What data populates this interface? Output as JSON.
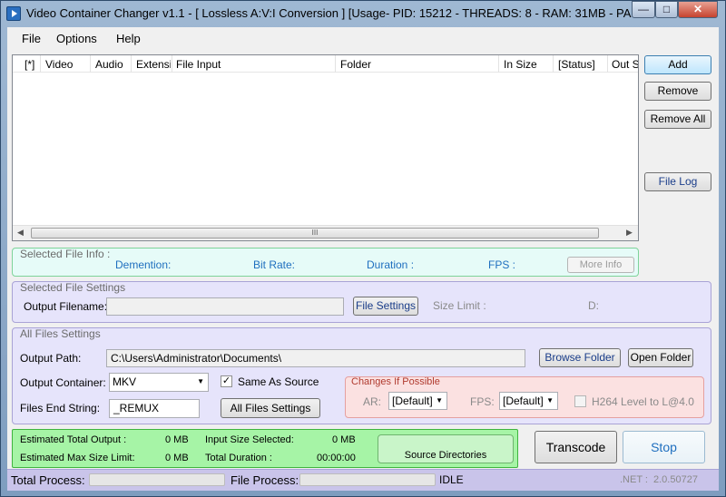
{
  "window": {
    "title": "Video Container Changer v1.1 - [ Lossless A:V:I Conversion ] [Usage- PID: 15212 - THREADS: 8 - RAM: 31MB - PA..."
  },
  "menu": {
    "file": "File",
    "options": "Options",
    "help": "Help"
  },
  "list": {
    "columns": [
      "[*]",
      "Video",
      "Audio",
      "Extensio",
      "File Input",
      "Folder",
      "In Size",
      "[Status]",
      "Out Si"
    ],
    "scroll_grip": "III"
  },
  "side_buttons": {
    "add": "Add",
    "remove": "Remove",
    "remove_all": "Remove All",
    "file_log": "File Log"
  },
  "selected_file_info": {
    "title": "Selected File Info :",
    "demention": "Demention:",
    "bit_rate": "Bit Rate:",
    "duration": "Duration :",
    "fps": "FPS :",
    "more_info": "More Info"
  },
  "selected_file_settings": {
    "title": "Selected File Settings",
    "output_filename_label": "Output Filename:",
    "output_filename_value": "",
    "file_settings_button": "File Settings",
    "size_limit_label": "Size Limit :",
    "drive_label": "D:"
  },
  "all_files_settings": {
    "title": "All Files Settings",
    "output_path_label": "Output Path:",
    "output_path_value": "C:\\Users\\Administrator\\Documents\\",
    "browse_folder": "Browse Folder",
    "open_folder": "Open Folder",
    "output_container_label": "Output Container:",
    "output_container_value": "MKV",
    "same_as_source_label": "Same As Source",
    "same_as_source_checked": true,
    "files_end_string_label": "Files End String:",
    "files_end_string_value": "_REMUX",
    "all_files_settings_button": "All Files Settings"
  },
  "changes": {
    "title": "Changes If Possible",
    "ar_label": "AR:",
    "ar_value": "[Default]",
    "fps_label": "FPS:",
    "fps_value": "[Default]",
    "h264_label": "H264 Level to L@4.0",
    "h264_checked": false
  },
  "estimates": {
    "total_output_label": "Estimated Total Output :",
    "total_output_value": "0 MB",
    "max_size_label": "Estimated Max Size Limit:",
    "max_size_value": "0 MB",
    "input_size_label": "Input Size Selected:",
    "input_size_value": "0 MB",
    "total_duration_label": "Total Duration :",
    "total_duration_value": "00:00:00",
    "source_directories": "Source Directories"
  },
  "actions": {
    "transcode": "Transcode",
    "stop": "Stop"
  },
  "status": {
    "total_process_label": "Total Process:",
    "file_process_label": "File Process:",
    "state": "IDLE",
    "dotnet": ".NET :",
    "version": "2.0.50727",
    "total_progress": 0,
    "file_progress": 0
  },
  "colors": {
    "info_group_bg": "#e6fbf8",
    "info_group_border": "#7ed39a",
    "settings_group_bg": "#e6e4fb",
    "settings_group_border": "#a9a3d6",
    "changes_bg": "#fbe1e1",
    "changes_border": "#e5a0a0",
    "estimates_bg": "#a6f4a6",
    "estimates_border": "#3fb43f"
  }
}
